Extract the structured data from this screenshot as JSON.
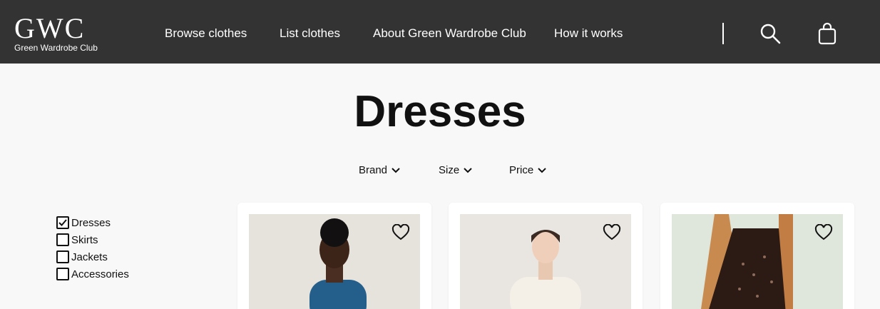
{
  "header": {
    "logo_mark": "GWC",
    "logo_sub": "Green Wardrobe Club",
    "nav": [
      {
        "label": "Browse clothes"
      },
      {
        "label": "List clothes"
      },
      {
        "label": "About Green Wardrobe Club"
      },
      {
        "label": "How it works"
      }
    ],
    "icons": [
      "search-icon",
      "shopping-bag-icon"
    ]
  },
  "page": {
    "title": "Dresses"
  },
  "filters": [
    {
      "label": "Brand"
    },
    {
      "label": "Size"
    },
    {
      "label": "Price"
    }
  ],
  "categories": [
    {
      "label": "Dresses",
      "checked": true
    },
    {
      "label": "Skirts",
      "checked": false
    },
    {
      "label": "Jackets",
      "checked": false
    },
    {
      "label": "Accessories",
      "checked": false
    }
  ],
  "products": [
    {
      "image": "model-blue-dress-photo"
    },
    {
      "image": "model-white-ruffle-dress-photo"
    },
    {
      "image": "model-dark-lace-dress-photo"
    }
  ],
  "colors": {
    "header_bg": "#333333",
    "page_bg": "#f8f8f8",
    "text": "#111111"
  }
}
